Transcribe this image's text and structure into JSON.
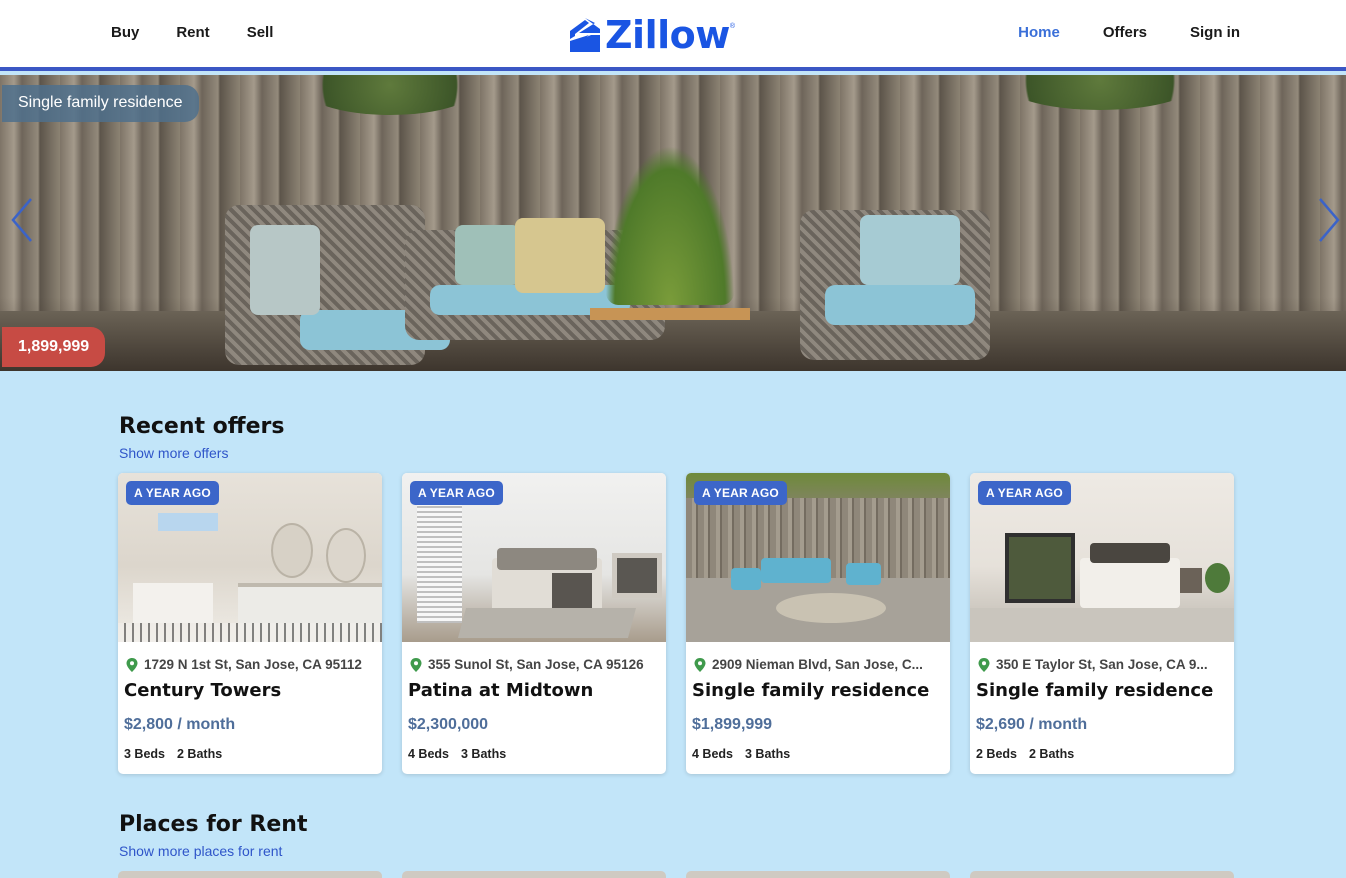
{
  "header": {
    "nav_left": [
      "Buy",
      "Rent",
      "Sell"
    ],
    "logo_text": "Zillow",
    "logo_reg": "®",
    "nav_right": {
      "home": "Home",
      "offers": "Offers",
      "sign_in": "Sign in"
    },
    "active_color": "#3a6fd8",
    "brand_color": "#1a55e3"
  },
  "hero": {
    "label": "Single family residence",
    "price": "1,899,999",
    "prev_icon": "chevron-left-icon",
    "next_icon": "chevron-right-icon"
  },
  "recent_offers": {
    "title": "Recent offers",
    "link": "Show more offers",
    "cards": [
      {
        "badge": "A YEAR AGO",
        "address": "1729 N 1st St, San Jose, CA 95112",
        "name": "Century Towers",
        "price": "$2,800 / month",
        "beds": "3 Beds",
        "baths": "2 Baths"
      },
      {
        "badge": "A YEAR AGO",
        "address": "355 Sunol St, San Jose, CA 95126",
        "name": "Patina at Midtown",
        "price": "$2,300,000",
        "beds": "4 Beds",
        "baths": "3 Baths"
      },
      {
        "badge": "A YEAR AGO",
        "address": "2909 Nieman Blvd, San Jose, C...",
        "name": "Single family residence",
        "price": "$1,899,999",
        "beds": "4 Beds",
        "baths": "3 Baths"
      },
      {
        "badge": "A YEAR AGO",
        "address": "350 E Taylor St, San Jose, CA 9...",
        "name": "Single family residence",
        "price": "$2,690 / month",
        "beds": "2 Beds",
        "baths": "2 Baths"
      }
    ]
  },
  "places_for_rent": {
    "title": "Places for Rent",
    "link": "Show more places for rent"
  }
}
